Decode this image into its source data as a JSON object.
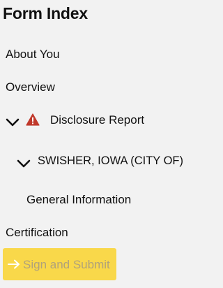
{
  "page": {
    "title": "Form Index"
  },
  "nav": {
    "about_you": "About You",
    "overview": "Overview",
    "disclosure_report": "Disclosure Report",
    "entity": "SWISHER, IOWA (CITY OF)",
    "general_information": "General Information",
    "certification": "Certification"
  },
  "actions": {
    "sign_and_submit": "Sign and Submit"
  },
  "icons": {
    "disclosure_status": "warning-icon",
    "disclosure_toggle": "chevron-down-icon",
    "entity_toggle": "chevron-down-icon",
    "submit": "arrow-right-icon"
  },
  "colors": {
    "background": "#f2f2f2",
    "warning": "#c0392b",
    "submit_button": "#f9d84a",
    "submit_text": "#b0a27a"
  }
}
